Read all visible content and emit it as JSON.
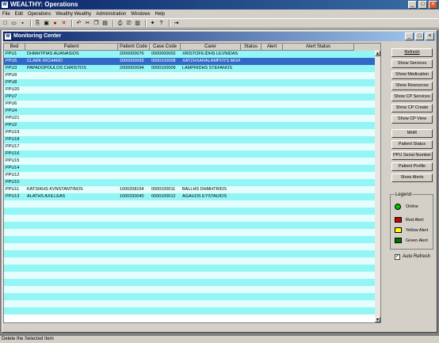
{
  "app": {
    "title": "WEALTHY: Operations",
    "icon_letter": "W"
  },
  "menu": [
    "File",
    "Edit",
    "Operations",
    "Wealthy Wealthy",
    "Administration",
    "Windows",
    "Help"
  ],
  "toolbar_icons": [
    "new-icon",
    "open-icon",
    "save-icon",
    "sep",
    "exit-icon",
    "save-alt-icon",
    "record-icon",
    "delete-icon",
    "sep",
    "undo-icon",
    "cut-icon",
    "copy-icon",
    "paste-icon",
    "sep",
    "print-icon",
    "print-preview-icon",
    "print-setup-icon",
    "sep",
    "tools-icon",
    "help-icon",
    "sep",
    "door-icon"
  ],
  "child": {
    "title": "Monitoring Center",
    "icon_letter": "W"
  },
  "grid": {
    "columns": [
      "Bed",
      "Patient",
      "Patient Code",
      "Case Code",
      "Carer",
      "Status",
      "Alert",
      "Alert Status"
    ],
    "rows": [
      [
        "PPU1",
        "DHMHTPIAS AUANASIOS",
        "2000000076",
        "0000000002",
        "XRISTOFILIDHS LEVNIDAS",
        "",
        "",
        ""
      ],
      [
        "PPU5",
        "CLARK RICHARD",
        "2000000093",
        "0000100008",
        "XATZHXARALAMPOYS MIXAHL",
        "",
        "",
        ""
      ],
      [
        "PPU3",
        "PAPADOPOULOS CHRISTOS",
        "2000000094",
        "0000100009",
        "LAMPRIDHS STEFANOS",
        "",
        "",
        ""
      ],
      [
        "PPU9",
        "",
        "",
        "",
        "",
        "",
        "",
        ""
      ],
      [
        "PPU8",
        "",
        "",
        "",
        "",
        "",
        "",
        ""
      ],
      [
        "PPU20",
        "",
        "",
        "",
        "",
        "",
        "",
        ""
      ],
      [
        "PPU7",
        "",
        "",
        "",
        "",
        "",
        "",
        ""
      ],
      [
        "PPU6",
        "",
        "",
        "",
        "",
        "",
        "",
        ""
      ],
      [
        "PPU4",
        "",
        "",
        "",
        "",
        "",
        "",
        ""
      ],
      [
        "PPU21",
        "",
        "",
        "",
        "",
        "",
        "",
        ""
      ],
      [
        "PPU2",
        "",
        "",
        "",
        "",
        "",
        "",
        ""
      ],
      [
        "PPU19",
        "",
        "",
        "",
        "",
        "",
        "",
        ""
      ],
      [
        "PPU18",
        "",
        "",
        "",
        "",
        "",
        "",
        ""
      ],
      [
        "PPU17",
        "",
        "",
        "",
        "",
        "",
        "",
        ""
      ],
      [
        "PPU16",
        "",
        "",
        "",
        "",
        "",
        "",
        ""
      ],
      [
        "PPU15",
        "",
        "",
        "",
        "",
        "",
        "",
        ""
      ],
      [
        "PPU14",
        "",
        "",
        "",
        "",
        "",
        "",
        ""
      ],
      [
        "PPU12",
        "",
        "",
        "",
        "",
        "",
        "",
        ""
      ],
      [
        "PPU10",
        "",
        "",
        "",
        "",
        "",
        "",
        ""
      ],
      [
        "PPU11",
        "KATSIKHS KVNSTANTINOS",
        "1000208154",
        "0000100011",
        "BALLHS DHMHTRIOS",
        "",
        "",
        ""
      ],
      [
        "PPU13",
        "ALATHS AXILLEAS",
        "1000330040",
        "0000100012",
        "AGAUOS EYSTAUIOS",
        "",
        "",
        ""
      ],
      [
        "",
        "",
        "",
        "",
        "",
        "",
        "",
        ""
      ],
      [
        "",
        "",
        "",
        "",
        "",
        "",
        "",
        ""
      ],
      [
        "",
        "",
        "",
        "",
        "",
        "",
        "",
        ""
      ],
      [
        "",
        "",
        "",
        "",
        "",
        "",
        "",
        ""
      ],
      [
        "",
        "",
        "",
        "",
        "",
        "",
        "",
        ""
      ],
      [
        "",
        "",
        "",
        "",
        "",
        "",
        "",
        ""
      ],
      [
        "",
        "",
        "",
        "",
        "",
        "",
        "",
        ""
      ],
      [
        "",
        "",
        "",
        "",
        "",
        "",
        "",
        ""
      ],
      [
        "",
        "",
        "",
        "",
        "",
        "",
        "",
        ""
      ],
      [
        "",
        "",
        "",
        "",
        "",
        "",
        "",
        ""
      ],
      [
        "",
        "",
        "",
        "",
        "",
        "",
        "",
        ""
      ],
      [
        "",
        "",
        "",
        "",
        "",
        "",
        "",
        ""
      ],
      [
        "",
        "",
        "",
        "",
        "",
        "",
        "",
        ""
      ],
      [
        "",
        "",
        "",
        "",
        "",
        "",
        "",
        ""
      ],
      [
        "",
        "",
        "",
        "",
        "",
        "",
        "",
        ""
      ],
      [
        "",
        "",
        "",
        "",
        "",
        "",
        "",
        ""
      ]
    ],
    "selected_row": 1
  },
  "buttons": {
    "refresh": "Refresh",
    "show_services": "Show Services",
    "show_medication": "Show Medication",
    "show_resources": "Show Resources",
    "show_cp_services": "Show CP Services",
    "show_cp_create": "Show CP Create",
    "show_cp_view": "Show CP View",
    "mhr": "MHR",
    "patient_status": "Patient Status",
    "ppu_serial": "PPU Serial Number",
    "patient_profile": "Patient Profile",
    "show_alerts": "Show Alerts"
  },
  "legend": {
    "title": "Legend",
    "items": [
      {
        "label": "Online",
        "color": "#00c000"
      },
      {
        "label": "Red Alert",
        "color": "#d40000"
      },
      {
        "label": "Yellow Alert",
        "color": "#ffff00"
      },
      {
        "label": "Green Alert",
        "color": "#007800"
      }
    ]
  },
  "auto_refresh": {
    "label": "Auto Refresh",
    "checked": true
  },
  "status": {
    "text": "Delete the Selected Item"
  }
}
